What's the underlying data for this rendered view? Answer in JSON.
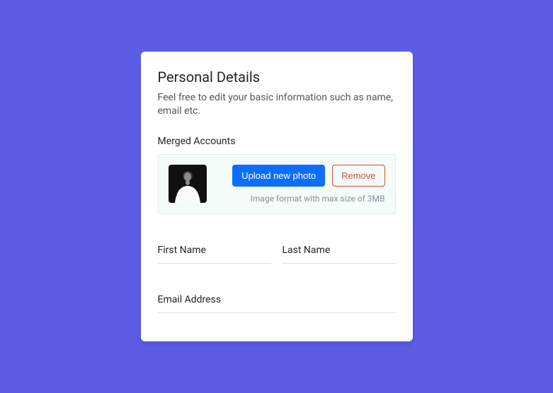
{
  "header": {
    "title": "Personal Details",
    "subtitle": "Feel free to edit your basic information such as name, email etc."
  },
  "photo": {
    "section_label": "Merged Accounts",
    "upload_button": "Upload new photo",
    "remove_button": "Remove",
    "hint": "Image format with max size of 3MB"
  },
  "fields": {
    "first_name": {
      "label": "First Name"
    },
    "last_name": {
      "label": "Last Name"
    },
    "email": {
      "label": "Email Address"
    }
  }
}
